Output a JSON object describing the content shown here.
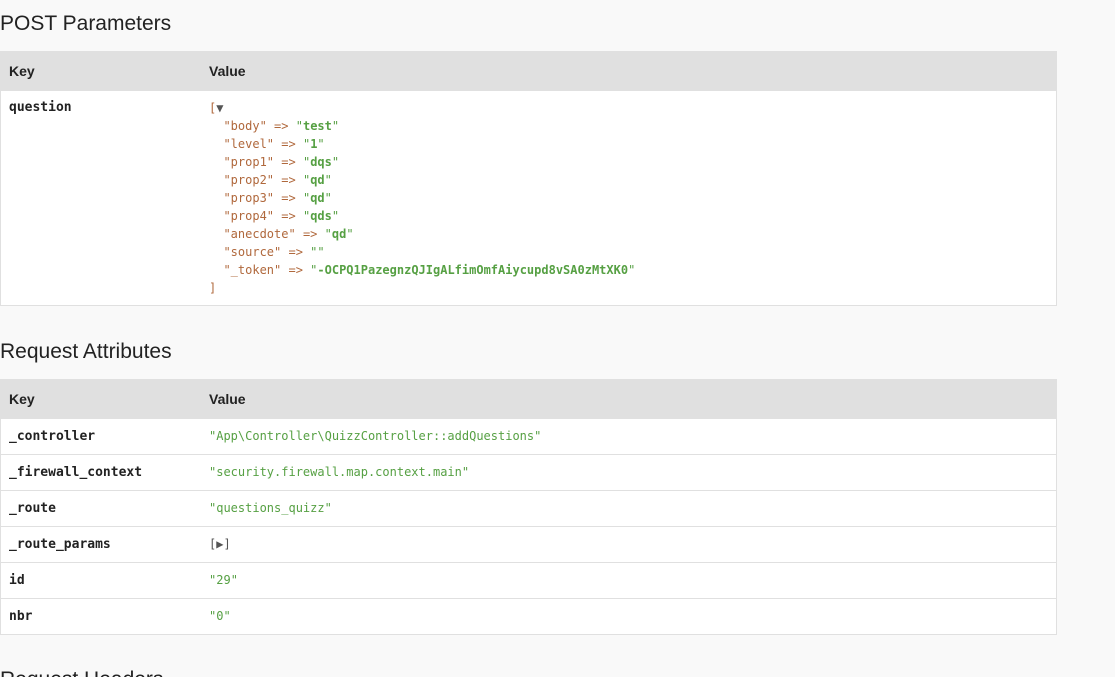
{
  "post_parameters": {
    "title": "POST Parameters",
    "key_header": "Key",
    "value_header": "Value",
    "row_key": "question",
    "open_bracket": "[",
    "toggle_open": "▼",
    "close_bracket": "]",
    "entries": [
      {
        "key": "\"body\"",
        "arrow": "=>",
        "value": "test"
      },
      {
        "key": "\"level\"",
        "arrow": "=>",
        "value": "1"
      },
      {
        "key": "\"prop1\"",
        "arrow": "=>",
        "value": "dqs"
      },
      {
        "key": "\"prop2\"",
        "arrow": "=>",
        "value": "qd"
      },
      {
        "key": "\"prop3\"",
        "arrow": "=>",
        "value": "qd"
      },
      {
        "key": "\"prop4\"",
        "arrow": "=>",
        "value": "qds"
      },
      {
        "key": "\"anecdote\"",
        "arrow": "=>",
        "value": "qd"
      },
      {
        "key": "\"source\"",
        "arrow": "=>",
        "value": ""
      },
      {
        "key": "\"_token\"",
        "arrow": "=>",
        "value": "-OCPQ1PazegnzQJIgALfimOmfAiycupd8vSA0zMtXK0"
      }
    ]
  },
  "request_attributes": {
    "title": "Request Attributes",
    "key_header": "Key",
    "value_header": "Value",
    "rows": [
      {
        "key": "_controller",
        "value": "App\\Controller\\QuizzController::addQuestions"
      },
      {
        "key": "_firewall_context",
        "value": "security.firewall.map.context.main"
      },
      {
        "key": "_route",
        "value": "questions_quizz"
      },
      {
        "key": "_route_params",
        "collapsed": "[▶]"
      },
      {
        "key": "id",
        "value": "29"
      },
      {
        "key": "nbr",
        "value": "0"
      }
    ]
  },
  "request_headers": {
    "title": "Request Headers"
  }
}
